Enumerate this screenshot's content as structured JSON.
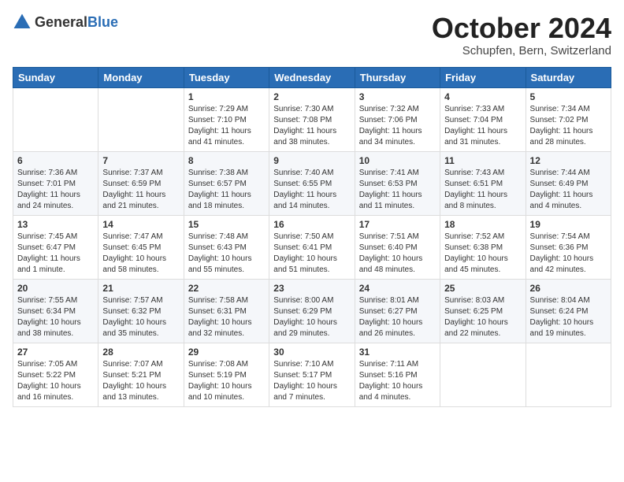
{
  "header": {
    "logo_general": "General",
    "logo_blue": "Blue",
    "month_title": "October 2024",
    "location": "Schupfen, Bern, Switzerland"
  },
  "weekdays": [
    "Sunday",
    "Monday",
    "Tuesday",
    "Wednesday",
    "Thursday",
    "Friday",
    "Saturday"
  ],
  "weeks": [
    [
      {
        "day": "",
        "info": ""
      },
      {
        "day": "",
        "info": ""
      },
      {
        "day": "1",
        "info": "Sunrise: 7:29 AM\nSunset: 7:10 PM\nDaylight: 11 hours and 41 minutes."
      },
      {
        "day": "2",
        "info": "Sunrise: 7:30 AM\nSunset: 7:08 PM\nDaylight: 11 hours and 38 minutes."
      },
      {
        "day": "3",
        "info": "Sunrise: 7:32 AM\nSunset: 7:06 PM\nDaylight: 11 hours and 34 minutes."
      },
      {
        "day": "4",
        "info": "Sunrise: 7:33 AM\nSunset: 7:04 PM\nDaylight: 11 hours and 31 minutes."
      },
      {
        "day": "5",
        "info": "Sunrise: 7:34 AM\nSunset: 7:02 PM\nDaylight: 11 hours and 28 minutes."
      }
    ],
    [
      {
        "day": "6",
        "info": "Sunrise: 7:36 AM\nSunset: 7:01 PM\nDaylight: 11 hours and 24 minutes."
      },
      {
        "day": "7",
        "info": "Sunrise: 7:37 AM\nSunset: 6:59 PM\nDaylight: 11 hours and 21 minutes."
      },
      {
        "day": "8",
        "info": "Sunrise: 7:38 AM\nSunset: 6:57 PM\nDaylight: 11 hours and 18 minutes."
      },
      {
        "day": "9",
        "info": "Sunrise: 7:40 AM\nSunset: 6:55 PM\nDaylight: 11 hours and 14 minutes."
      },
      {
        "day": "10",
        "info": "Sunrise: 7:41 AM\nSunset: 6:53 PM\nDaylight: 11 hours and 11 minutes."
      },
      {
        "day": "11",
        "info": "Sunrise: 7:43 AM\nSunset: 6:51 PM\nDaylight: 11 hours and 8 minutes."
      },
      {
        "day": "12",
        "info": "Sunrise: 7:44 AM\nSunset: 6:49 PM\nDaylight: 11 hours and 4 minutes."
      }
    ],
    [
      {
        "day": "13",
        "info": "Sunrise: 7:45 AM\nSunset: 6:47 PM\nDaylight: 11 hours and 1 minute."
      },
      {
        "day": "14",
        "info": "Sunrise: 7:47 AM\nSunset: 6:45 PM\nDaylight: 10 hours and 58 minutes."
      },
      {
        "day": "15",
        "info": "Sunrise: 7:48 AM\nSunset: 6:43 PM\nDaylight: 10 hours and 55 minutes."
      },
      {
        "day": "16",
        "info": "Sunrise: 7:50 AM\nSunset: 6:41 PM\nDaylight: 10 hours and 51 minutes."
      },
      {
        "day": "17",
        "info": "Sunrise: 7:51 AM\nSunset: 6:40 PM\nDaylight: 10 hours and 48 minutes."
      },
      {
        "day": "18",
        "info": "Sunrise: 7:52 AM\nSunset: 6:38 PM\nDaylight: 10 hours and 45 minutes."
      },
      {
        "day": "19",
        "info": "Sunrise: 7:54 AM\nSunset: 6:36 PM\nDaylight: 10 hours and 42 minutes."
      }
    ],
    [
      {
        "day": "20",
        "info": "Sunrise: 7:55 AM\nSunset: 6:34 PM\nDaylight: 10 hours and 38 minutes."
      },
      {
        "day": "21",
        "info": "Sunrise: 7:57 AM\nSunset: 6:32 PM\nDaylight: 10 hours and 35 minutes."
      },
      {
        "day": "22",
        "info": "Sunrise: 7:58 AM\nSunset: 6:31 PM\nDaylight: 10 hours and 32 minutes."
      },
      {
        "day": "23",
        "info": "Sunrise: 8:00 AM\nSunset: 6:29 PM\nDaylight: 10 hours and 29 minutes."
      },
      {
        "day": "24",
        "info": "Sunrise: 8:01 AM\nSunset: 6:27 PM\nDaylight: 10 hours and 26 minutes."
      },
      {
        "day": "25",
        "info": "Sunrise: 8:03 AM\nSunset: 6:25 PM\nDaylight: 10 hours and 22 minutes."
      },
      {
        "day": "26",
        "info": "Sunrise: 8:04 AM\nSunset: 6:24 PM\nDaylight: 10 hours and 19 minutes."
      }
    ],
    [
      {
        "day": "27",
        "info": "Sunrise: 7:05 AM\nSunset: 5:22 PM\nDaylight: 10 hours and 16 minutes."
      },
      {
        "day": "28",
        "info": "Sunrise: 7:07 AM\nSunset: 5:21 PM\nDaylight: 10 hours and 13 minutes."
      },
      {
        "day": "29",
        "info": "Sunrise: 7:08 AM\nSunset: 5:19 PM\nDaylight: 10 hours and 10 minutes."
      },
      {
        "day": "30",
        "info": "Sunrise: 7:10 AM\nSunset: 5:17 PM\nDaylight: 10 hours and 7 minutes."
      },
      {
        "day": "31",
        "info": "Sunrise: 7:11 AM\nSunset: 5:16 PM\nDaylight: 10 hours and 4 minutes."
      },
      {
        "day": "",
        "info": ""
      },
      {
        "day": "",
        "info": ""
      }
    ]
  ]
}
